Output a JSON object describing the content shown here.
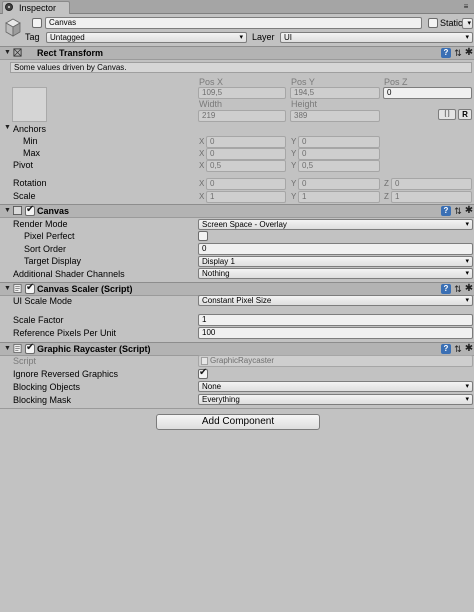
{
  "window": {
    "tab_label": "Inspector"
  },
  "gameobject": {
    "name": "Canvas",
    "static_label": "Static",
    "tag_label": "Tag",
    "tag_value": "Untagged",
    "layer_label": "Layer",
    "layer_value": "UI"
  },
  "rect_transform": {
    "title": "Rect Transform",
    "info": "Some values driven by Canvas.",
    "pos_x_label": "Pos X",
    "pos_y_label": "Pos Y",
    "pos_z_label": "Pos Z",
    "pos_x": "109,5",
    "pos_y": "194,5",
    "pos_z": "0",
    "width_label": "Width",
    "height_label": "Height",
    "width": "219",
    "height": "389",
    "blueprint_btn": "[ ]",
    "raw_btn": "R",
    "anchors_label": "Anchors",
    "min_label": "Min",
    "max_label": "Max",
    "min_x": "0",
    "min_y": "0",
    "max_x": "0",
    "max_y": "0",
    "pivot_label": "Pivot",
    "pivot_x": "0,5",
    "pivot_y": "0,5",
    "rotation_label": "Rotation",
    "rot_x": "0",
    "rot_y": "0",
    "rot_z": "0",
    "scale_label": "Scale",
    "scale_x": "1",
    "scale_y": "1",
    "scale_z": "1",
    "axis_x": "X",
    "axis_y": "Y",
    "axis_z": "Z"
  },
  "canvas": {
    "title": "Canvas",
    "render_mode_label": "Render Mode",
    "render_mode": "Screen Space - Overlay",
    "pixel_perfect_label": "Pixel Perfect",
    "sort_order_label": "Sort Order",
    "sort_order": "0",
    "target_display_label": "Target Display",
    "target_display": "Display 1",
    "shader_channels_label": "Additional Shader Channels",
    "shader_channels": "Nothing"
  },
  "canvas_scaler": {
    "title": "Canvas Scaler (Script)",
    "ui_scale_mode_label": "UI Scale Mode",
    "ui_scale_mode": "Constant Pixel Size",
    "scale_factor_label": "Scale Factor",
    "scale_factor": "1",
    "ref_ppu_label": "Reference Pixels Per Unit",
    "ref_ppu": "100"
  },
  "graphic_raycaster": {
    "title": "Graphic Raycaster (Script)",
    "script_label": "Script",
    "script_value": "GraphicRaycaster",
    "ignore_reversed_label": "Ignore Reversed Graphics",
    "blocking_objects_label": "Blocking Objects",
    "blocking_objects": "None",
    "blocking_mask_label": "Blocking Mask",
    "blocking_mask": "Everything"
  },
  "add_component_label": "Add Component",
  "icons": {
    "help": "?",
    "preset": "⇅",
    "gear": "✱",
    "fold": "▼",
    "dropdown": "▾",
    "menu": "≡"
  },
  "colors": {
    "background": "#c2c2c2",
    "header": "#b3b3b3",
    "help_icon": "#3a6fb4"
  }
}
